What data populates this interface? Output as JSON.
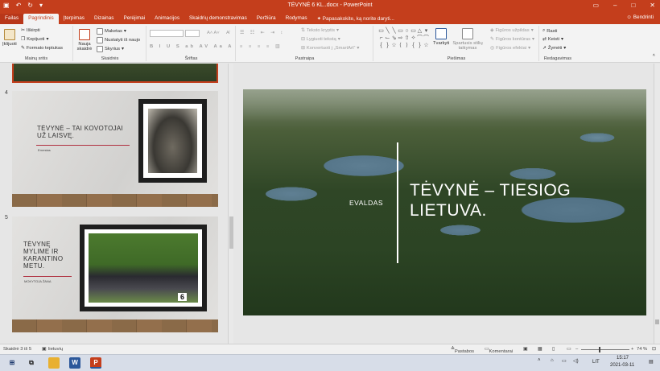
{
  "window": {
    "title": "TĖVYNĖ 6 KL..docx - PowerPoint",
    "share_label": "Bendrinti"
  },
  "tabs": [
    "Failas",
    "Pagrindinis",
    "Įterpimas",
    "Dizainas",
    "Perėjimai",
    "Animacijos",
    "Skaidrių demonstravimas",
    "Peržiūra",
    "Rodymas"
  ],
  "tellme": "Papasakokite, ką norite daryti...",
  "ribbon": {
    "clipboard": {
      "paste": "Įklijuoti",
      "cut": "Iškirpti",
      "copy": "Kopijuoti",
      "format": "Formato teptukas",
      "label": "Mainų sritis"
    },
    "slides": {
      "new": "Nauja skaidrė",
      "layout": "Maketas",
      "reset": "Nustatyti iš naujo",
      "section": "Skyrius",
      "label": "Skaidrės"
    },
    "font": {
      "label": "Šriftas"
    },
    "paragraph": {
      "direction": "Teksto kryptis",
      "align": "Lygiuoti tekstą",
      "smartart": "Konvertuoti į „SmartArt“",
      "label": "Pastraipa"
    },
    "drawing": {
      "arrange": "Tvarkyti",
      "quickstyles": "Spartusis stilių taikymas",
      "fill": "Figūros užpildas",
      "outline": "Figūros kontūras",
      "effects": "Figūros efektai",
      "label": "Piešimas"
    },
    "editing": {
      "find": "Rasti",
      "replace": "Keisti",
      "select": "Žymėti",
      "label": "Redagavimas"
    }
  },
  "slides": {
    "s4": {
      "num": "4",
      "title": "TĖVYNĖ – TAI KOVOTOJAI UŽ LAISVĘ.",
      "subtitle": "Ernestas"
    },
    "s5": {
      "num": "5",
      "title": "TĖVYNĘ MYLIME IR KARANTINO METU.",
      "subtitle": "MOKYTOJA ŽANA",
      "photo_number": "6"
    }
  },
  "main_slide": {
    "author": "EVALDAS",
    "title_line1": "TĖVYNĖ – TIESIOG",
    "title_line2": "LIETUVA."
  },
  "status": {
    "slide_counter": "Skaidrė 3 iš 5",
    "language": "lietuvių",
    "notes": "Pastabos",
    "comments": "Komentarai",
    "zoom": "74 %"
  },
  "taskbar": {
    "time": "15:17",
    "date": "2021-03-11",
    "lang": "LIT"
  },
  "colors": {
    "accent": "#c43e1c",
    "ribbon_bg": "#f3f3f3",
    "panel_bg": "#e6e6e6"
  }
}
